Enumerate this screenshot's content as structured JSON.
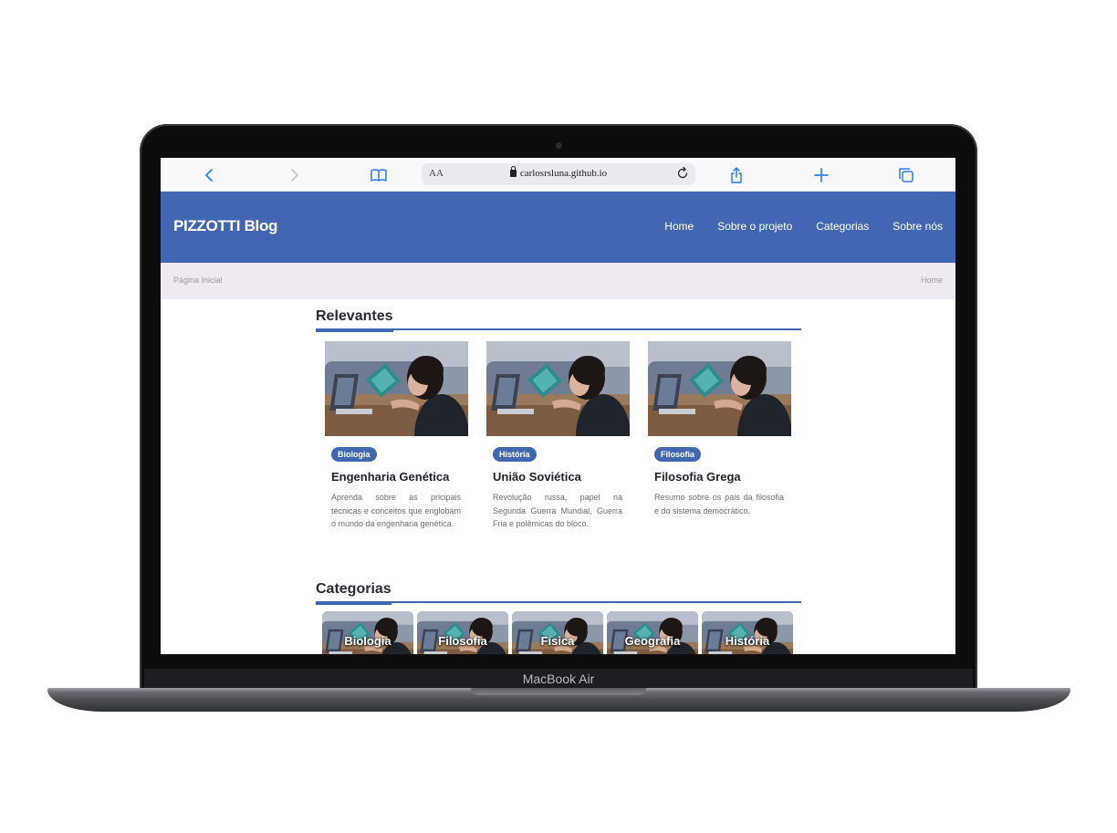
{
  "device": {
    "label": "MacBook Air"
  },
  "browser": {
    "url": "carlosrsluna.github.io",
    "text_size_label": "AA",
    "icons": [
      "back-icon",
      "forward-icon",
      "bookmarks-icon",
      "lock-icon",
      "reload-icon",
      "share-icon",
      "new-tab-icon",
      "tabs-icon"
    ]
  },
  "header": {
    "brand": "PIZZOTTI Blog",
    "nav": [
      "Home",
      "Sobre o projeto",
      "Categorias",
      "Sobre nós"
    ]
  },
  "breadcrumb": {
    "left": "Página Inicial",
    "right": "Home"
  },
  "relevantes": {
    "title": "Relevantes",
    "cards": [
      {
        "badge": "Biologia",
        "title": "Engenharia Genética",
        "text": "Aprenda sobre as pricipais técnicas e conceitos que englobam o mundo da engenharia genética."
      },
      {
        "badge": "História",
        "title": "União Soviética",
        "text": "Revolução russa, papel na Segunda Guerra Mundial, Guerra Fria e polêmicas do bloco."
      },
      {
        "badge": "Filosofia",
        "title": "Filosofia Grega",
        "text": "Resumo sobre os pais da filosofia e do sistema democrático."
      }
    ]
  },
  "categorias": {
    "title": "Categorias",
    "items": [
      "Biologia",
      "Filosofia",
      "Física",
      "Geografia",
      "História"
    ]
  },
  "colors": {
    "brand_blue": "#4267b2",
    "crumb_bg": "#efeaf2"
  }
}
